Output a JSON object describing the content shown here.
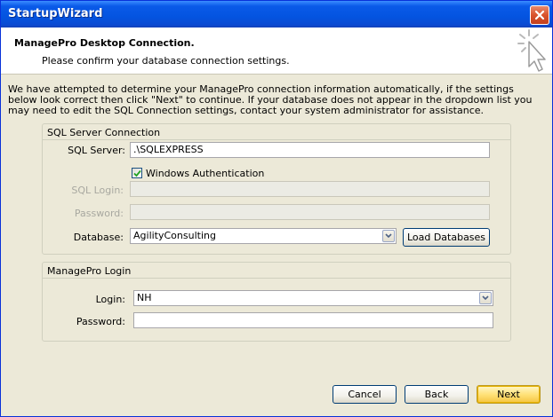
{
  "window": {
    "title": "StartupWizard"
  },
  "header": {
    "title": "ManagePro Desktop Connection.",
    "subtitle": "Please confirm your database connection settings."
  },
  "intro_text": "We have attempted to determine your ManagePro connection information automatically, if the settings below look correct then click \"Next\" to continue.  If your database does not appear in the dropdown list you may need to edit the SQL Connection settings, contact your system administrator for assistance.",
  "sql_group": {
    "title": "SQL Server Connection",
    "server_label": "SQL Server:",
    "server_value": ".\\SQLEXPRESS",
    "windows_auth_label": "Windows Authentication",
    "windows_auth_checked": true,
    "login_label": "SQL Login:",
    "password_label": "Password:",
    "database_label": "Database:",
    "database_value": "AgilityConsulting",
    "load_button": "Load Databases"
  },
  "mp_group": {
    "title": "ManagePro Login",
    "login_label": "Login:",
    "login_value": "NH",
    "password_label": "Password:"
  },
  "buttons": {
    "cancel": "Cancel",
    "back": "Back",
    "next": "Next"
  },
  "icons": {
    "close": "close-icon",
    "wizard": "wizard-cursor-icon",
    "dropdown": "chevron-down-icon",
    "check": "checkmark-icon"
  }
}
